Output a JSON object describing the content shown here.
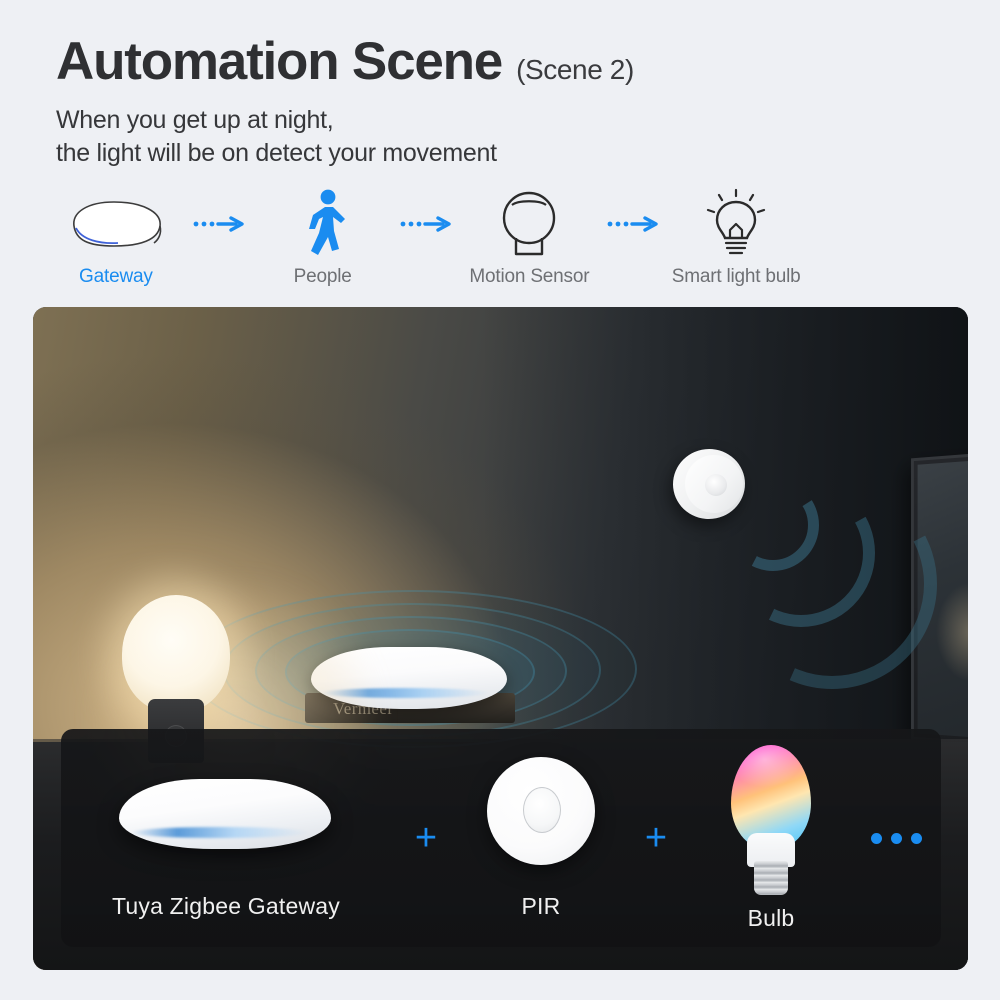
{
  "page": {
    "background_color": "#eef0f4",
    "accent_color": "#1a8cf0"
  },
  "header": {
    "title": "Automation Scene",
    "title_suffix": "(Scene 2)",
    "description_line1": "When you get up at night,",
    "description_line2": "the light will be on detect your movement"
  },
  "flow": {
    "arrow_label": "arrow-right",
    "nodes": [
      {
        "label": "Gateway",
        "icon": "gateway-icon",
        "highlighted": true
      },
      {
        "label": "People",
        "icon": "walking-person-icon",
        "highlighted": false
      },
      {
        "label": "Motion Sensor",
        "icon": "motion-sensor-icon",
        "highlighted": false
      },
      {
        "label": "Smart light bulb",
        "icon": "light-bulb-icon",
        "highlighted": false
      }
    ]
  },
  "scene_photo": {
    "book_text": "Vermeer",
    "alt": "night bedside scene with gateway, motion sensor and lamp"
  },
  "product_strip": {
    "items": [
      {
        "label": "Tuya Zigbee Gateway",
        "icon": "zigbee-gateway-product"
      },
      {
        "label": "PIR",
        "icon": "pir-sensor-product"
      },
      {
        "label": "Bulb",
        "icon": "rgb-bulb-product"
      }
    ],
    "separator": "+",
    "more_indicator": "•••"
  }
}
